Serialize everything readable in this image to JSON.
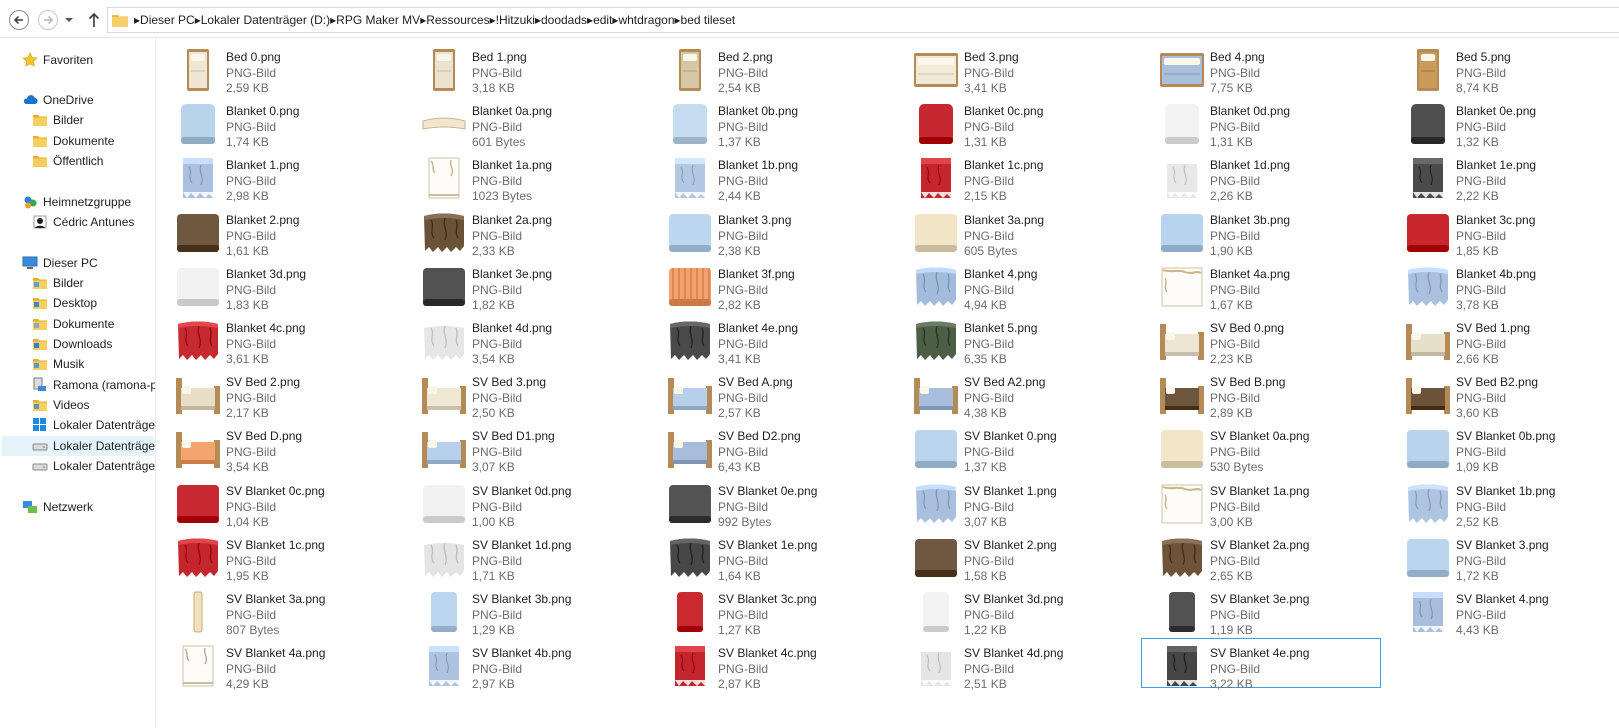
{
  "navigation": {
    "back_icon": "back-arrow-icon",
    "forward_icon": "forward-arrow-icon",
    "history_icon": "chevron-down-icon",
    "up_icon": "up-arrow-icon"
  },
  "breadcrumb": [
    "Dieser PC",
    "Lokaler Datenträger (D:)",
    "RPG Maker MV",
    "Ressources",
    "!Hitzuki",
    "doodads",
    "edit",
    "whtdragon",
    "bed tileset"
  ],
  "sidebar": [
    {
      "label": "Favoriten",
      "icon": "star-icon",
      "level": 0
    },
    {
      "label": "OneDrive",
      "icon": "cloud-icon",
      "level": 0
    },
    {
      "label": "Bilder",
      "icon": "folder-icon",
      "level": 1
    },
    {
      "label": "Dokumente",
      "icon": "folder-icon",
      "level": 1
    },
    {
      "label": "Öffentlich",
      "icon": "folder-icon",
      "level": 1
    },
    {
      "label": "Heimnetzgruppe",
      "icon": "homegroup-icon",
      "level": 0
    },
    {
      "label": "Cédric Antunes",
      "icon": "user-icon",
      "level": 1
    },
    {
      "label": "Dieser PC",
      "icon": "computer-icon",
      "level": 0
    },
    {
      "label": "Bilder",
      "icon": "pictures-folder-icon",
      "level": 1
    },
    {
      "label": "Desktop",
      "icon": "desktop-folder-icon",
      "level": 1
    },
    {
      "label": "Dokumente",
      "icon": "documents-folder-icon",
      "level": 1
    },
    {
      "label": "Downloads",
      "icon": "downloads-folder-icon",
      "level": 1
    },
    {
      "label": "Musik",
      "icon": "music-folder-icon",
      "level": 1
    },
    {
      "label": "Ramona (ramona-pc",
      "icon": "network-computer-icon",
      "level": 1
    },
    {
      "label": "Videos",
      "icon": "videos-folder-icon",
      "level": 1
    },
    {
      "label": "Lokaler Datenträger",
      "icon": "windows-drive-icon",
      "level": 1
    },
    {
      "label": "Lokaler Datenträger",
      "icon": "drive-icon",
      "level": 1,
      "selected": true
    },
    {
      "label": "Lokaler Datenträger",
      "icon": "drive-icon",
      "level": 1
    },
    {
      "label": "Netzwerk",
      "icon": "network-icon",
      "level": 0
    }
  ],
  "files": [
    {
      "name": "Bed 0.png",
      "type": "PNG-Bild",
      "size": "2,59 KB",
      "kind": "bed-tall",
      "color": "#efe6d3"
    },
    {
      "name": "Bed 1.png",
      "type": "PNG-Bild",
      "size": "3,18 KB",
      "kind": "bed-tall",
      "color": "#ece3cf"
    },
    {
      "name": "Bed 2.png",
      "type": "PNG-Bild",
      "size": "2,54 KB",
      "kind": "bed-tall",
      "color": "#d6c7a6"
    },
    {
      "name": "Bed 3.png",
      "type": "PNG-Bild",
      "size": "3,41 KB",
      "kind": "bed-wide",
      "color": "#f2e9d6"
    },
    {
      "name": "Bed 4.png",
      "type": "PNG-Bild",
      "size": "7,75 KB",
      "kind": "bed-wide",
      "color": "#a9bfdc"
    },
    {
      "name": "Bed 5.png",
      "type": "PNG-Bild",
      "size": "8,74 KB",
      "kind": "bed-tall",
      "color": "#c99a5a"
    },
    {
      "name": "Blanket 0.png",
      "type": "PNG-Bild",
      "size": "1,74 KB",
      "kind": "square",
      "color": "#b9d3eb"
    },
    {
      "name": "Blanket 0a.png",
      "type": "PNG-Bild",
      "size": "601 Bytes",
      "kind": "strip",
      "color": "#f0e6d1"
    },
    {
      "name": "Blanket 0b.png",
      "type": "PNG-Bild",
      "size": "1,37 KB",
      "kind": "square",
      "color": "#c4dcef"
    },
    {
      "name": "Blanket 0c.png",
      "type": "PNG-Bild",
      "size": "1,31 KB",
      "kind": "square",
      "color": "#c7282f"
    },
    {
      "name": "Blanket 0d.png",
      "type": "PNG-Bild",
      "size": "1,31 KB",
      "kind": "square",
      "color": "#f3f3f3"
    },
    {
      "name": "Blanket 0e.png",
      "type": "PNG-Bild",
      "size": "1,32 KB",
      "kind": "square",
      "color": "#505050"
    },
    {
      "name": "Blanket 1.png",
      "type": "PNG-Bild",
      "size": "2,98 KB",
      "kind": "tall-blanket",
      "color": "#a9c0de"
    },
    {
      "name": "Blanket 1a.png",
      "type": "PNG-Bild",
      "size": "1023 Bytes",
      "kind": "tall-sparse",
      "color": "#eae0cc"
    },
    {
      "name": "Blanket 1b.png",
      "type": "PNG-Bild",
      "size": "2,44 KB",
      "kind": "tall-blanket",
      "color": "#b3c8e2"
    },
    {
      "name": "Blanket 1c.png",
      "type": "PNG-Bild",
      "size": "2,15 KB",
      "kind": "tall-blanket",
      "color": "#c3262d"
    },
    {
      "name": "Blanket 1d.png",
      "type": "PNG-Bild",
      "size": "2,26 KB",
      "kind": "tall-blanket",
      "color": "#e8e8e8"
    },
    {
      "name": "Blanket 1e.png",
      "type": "PNG-Bild",
      "size": "2,22 KB",
      "kind": "tall-blanket",
      "color": "#4b4b4b"
    },
    {
      "name": "Blanket 2.png",
      "type": "PNG-Bild",
      "size": "1,61 KB",
      "kind": "wide",
      "color": "#6e5840"
    },
    {
      "name": "Blanket 2a.png",
      "type": "PNG-Bild",
      "size": "2,33 KB",
      "kind": "wide-rag",
      "color": "#6a5238"
    },
    {
      "name": "Blanket 3.png",
      "type": "PNG-Bild",
      "size": "2,38 KB",
      "kind": "wide",
      "color": "#bcd6ef"
    },
    {
      "name": "Blanket 3a.png",
      "type": "PNG-Bild",
      "size": "605 Bytes",
      "kind": "wide",
      "color": "#f2e5c5"
    },
    {
      "name": "Blanket 3b.png",
      "type": "PNG-Bild",
      "size": "1,90 KB",
      "kind": "wide",
      "color": "#b8d3ee"
    },
    {
      "name": "Blanket 3c.png",
      "type": "PNG-Bild",
      "size": "1,85 KB",
      "kind": "wide",
      "color": "#c8272e"
    },
    {
      "name": "Blanket 3d.png",
      "type": "PNG-Bild",
      "size": "1,83 KB",
      "kind": "wide",
      "color": "#f1f1f1"
    },
    {
      "name": "Blanket 3e.png",
      "type": "PNG-Bild",
      "size": "1,82 KB",
      "kind": "wide",
      "color": "#525252"
    },
    {
      "name": "Blanket 3f.png",
      "type": "PNG-Bild",
      "size": "2,82 KB",
      "kind": "wide",
      "color": "#f3a16d"
    },
    {
      "name": "Blanket 4.png",
      "type": "PNG-Bild",
      "size": "4,94 KB",
      "kind": "wide-rag",
      "color": "#a4bcdb"
    },
    {
      "name": "Blanket 4a.png",
      "type": "PNG-Bild",
      "size": "1,67 KB",
      "kind": "wide-sparse",
      "color": "#e7dcc4"
    },
    {
      "name": "Blanket 4b.png",
      "type": "PNG-Bild",
      "size": "3,78 KB",
      "kind": "wide-rag",
      "color": "#a9c1de"
    },
    {
      "name": "Blanket 4c.png",
      "type": "PNG-Bild",
      "size": "3,61 KB",
      "kind": "wide-rag",
      "color": "#c52a30"
    },
    {
      "name": "Blanket 4d.png",
      "type": "PNG-Bild",
      "size": "3,54 KB",
      "kind": "wide-rag",
      "color": "#e6e6e6"
    },
    {
      "name": "Blanket 4e.png",
      "type": "PNG-Bild",
      "size": "3,41 KB",
      "kind": "wide-rag",
      "color": "#4a4a4a"
    },
    {
      "name": "Blanket 5.png",
      "type": "PNG-Bild",
      "size": "6,35 KB",
      "kind": "wide-rag",
      "color": "#4c5e46"
    },
    {
      "name": "SV Bed 0.png",
      "type": "PNG-Bild",
      "size": "2,23 KB",
      "kind": "sv-bed",
      "color": "#eee5d2"
    },
    {
      "name": "SV Bed 1.png",
      "type": "PNG-Bild",
      "size": "2,66 KB",
      "kind": "sv-bed",
      "color": "#e8dfcb"
    },
    {
      "name": "SV Bed 2.png",
      "type": "PNG-Bild",
      "size": "2,17 KB",
      "kind": "sv-bed",
      "color": "#e9dec6"
    },
    {
      "name": "SV Bed 3.png",
      "type": "PNG-Bild",
      "size": "2,50 KB",
      "kind": "sv-bed",
      "color": "#f1e8d4"
    },
    {
      "name": "SV Bed A.png",
      "type": "PNG-Bild",
      "size": "2,57 KB",
      "kind": "sv-bed",
      "color": "#b6cfea"
    },
    {
      "name": "SV Bed A2.png",
      "type": "PNG-Bild",
      "size": "4,38 KB",
      "kind": "sv-bed",
      "color": "#a7bedc"
    },
    {
      "name": "SV Bed B.png",
      "type": "PNG-Bild",
      "size": "2,89 KB",
      "kind": "sv-bed",
      "color": "#6c563e"
    },
    {
      "name": "SV Bed B2.png",
      "type": "PNG-Bild",
      "size": "3,60 KB",
      "kind": "sv-bed",
      "color": "#6b5239"
    },
    {
      "name": "SV Bed D.png",
      "type": "PNG-Bild",
      "size": "3,54 KB",
      "kind": "sv-bed",
      "color": "#f4a46f"
    },
    {
      "name": "SV Bed D1.png",
      "type": "PNG-Bild",
      "size": "3,07 KB",
      "kind": "sv-bed",
      "color": "#b7d0ec"
    },
    {
      "name": "SV Bed D2.png",
      "type": "PNG-Bild",
      "size": "6,43 KB",
      "kind": "sv-bed",
      "color": "#a6bedb"
    },
    {
      "name": "SV Blanket 0.png",
      "type": "PNG-Bild",
      "size": "1,37 KB",
      "kind": "wide",
      "color": "#bad4ee"
    },
    {
      "name": "SV Blanket 0a.png",
      "type": "PNG-Bild",
      "size": "530 Bytes",
      "kind": "wide",
      "color": "#f2e6c9"
    },
    {
      "name": "SV Blanket 0b.png",
      "type": "PNG-Bild",
      "size": "1,09 KB",
      "kind": "wide",
      "color": "#bad3ed"
    },
    {
      "name": "SV Blanket 0c.png",
      "type": "PNG-Bild",
      "size": "1,04 KB",
      "kind": "wide",
      "color": "#c8282f"
    },
    {
      "name": "SV Blanket 0d.png",
      "type": "PNG-Bild",
      "size": "1,00 KB",
      "kind": "wide",
      "color": "#f2f2f2"
    },
    {
      "name": "SV Blanket 0e.png",
      "type": "PNG-Bild",
      "size": "992 Bytes",
      "kind": "wide",
      "color": "#545454"
    },
    {
      "name": "SV Blanket 1.png",
      "type": "PNG-Bild",
      "size": "3,07 KB",
      "kind": "wide-rag",
      "color": "#a8c0de"
    },
    {
      "name": "SV Blanket 1a.png",
      "type": "PNG-Bild",
      "size": "3,00 KB",
      "kind": "wide-sparse",
      "color": "#e9dfca"
    },
    {
      "name": "SV Blanket 1b.png",
      "type": "PNG-Bild",
      "size": "2,52 KB",
      "kind": "wide-rag",
      "color": "#aec5e1"
    },
    {
      "name": "SV Blanket 1c.png",
      "type": "PNG-Bild",
      "size": "1,95 KB",
      "kind": "wide-rag",
      "color": "#c3262d"
    },
    {
      "name": "SV Blanket 1d.png",
      "type": "PNG-Bild",
      "size": "1,71 KB",
      "kind": "wide-rag",
      "color": "#e4e4e4"
    },
    {
      "name": "SV Blanket 1e.png",
      "type": "PNG-Bild",
      "size": "1,64 KB",
      "kind": "wide-rag",
      "color": "#474747"
    },
    {
      "name": "SV Blanket 2.png",
      "type": "PNG-Bild",
      "size": "1,58 KB",
      "kind": "wide",
      "color": "#6e5841"
    },
    {
      "name": "SV Blanket 2a.png",
      "type": "PNG-Bild",
      "size": "2,65 KB",
      "kind": "wide-rag",
      "color": "#6c5339"
    },
    {
      "name": "SV Blanket 3.png",
      "type": "PNG-Bild",
      "size": "1,72 KB",
      "kind": "wide",
      "color": "#bbd5ef"
    },
    {
      "name": "SV Blanket 3a.png",
      "type": "PNG-Bild",
      "size": "807 Bytes",
      "kind": "thin",
      "color": "#f0e2bf"
    },
    {
      "name": "SV Blanket 3b.png",
      "type": "PNG-Bild",
      "size": "1,29 KB",
      "kind": "narrow",
      "color": "#bcd6ef"
    },
    {
      "name": "SV Blanket 3c.png",
      "type": "PNG-Bild",
      "size": "1,27 KB",
      "kind": "narrow",
      "color": "#c9292f"
    },
    {
      "name": "SV Blanket 3d.png",
      "type": "PNG-Bild",
      "size": "1,22 KB",
      "kind": "narrow",
      "color": "#f3f3f3"
    },
    {
      "name": "SV Blanket 3e.png",
      "type": "PNG-Bild",
      "size": "1,19 KB",
      "kind": "narrow",
      "color": "#535353"
    },
    {
      "name": "SV Blanket 4.png",
      "type": "PNG-Bild",
      "size": "4,43 KB",
      "kind": "tall-blanket",
      "color": "#a7bfdd"
    },
    {
      "name": "SV Blanket 4a.png",
      "type": "PNG-Bild",
      "size": "4,29 KB",
      "kind": "tall-sparse",
      "color": "#e8ddc7"
    },
    {
      "name": "SV Blanket 4b.png",
      "type": "PNG-Bild",
      "size": "2,97 KB",
      "kind": "tall-blanket",
      "color": "#adc4e0"
    },
    {
      "name": "SV Blanket 4c.png",
      "type": "PNG-Bild",
      "size": "2,87 KB",
      "kind": "tall-blanket",
      "color": "#c2252c"
    },
    {
      "name": "SV Blanket 4d.png",
      "type": "PNG-Bild",
      "size": "2,51 KB",
      "kind": "tall-blanket",
      "color": "#e5e5e5"
    },
    {
      "name": "SV Blanket 4e.png",
      "type": "PNG-Bild",
      "size": "3,22 KB",
      "kind": "tall-blanket",
      "color": "#454545",
      "selected": true
    }
  ]
}
